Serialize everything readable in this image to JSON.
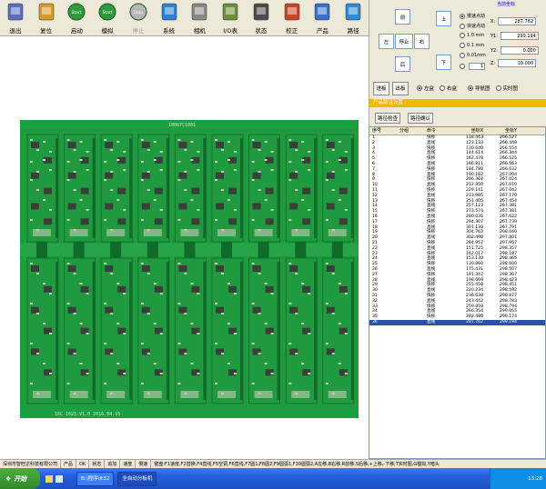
{
  "toolbar": {
    "items": [
      {
        "label": "退出",
        "icon": "exit-icon",
        "enabled": true
      },
      {
        "label": "复位",
        "icon": "reset-icon",
        "enabled": true
      },
      {
        "label": "启动",
        "icon": "start-icon",
        "enabled": true,
        "icon_text": "Start"
      },
      {
        "label": "模拟",
        "icon": "simulate-icon",
        "enabled": true,
        "icon_text": "Start"
      },
      {
        "label": "停止",
        "icon": "stop-icon",
        "enabled": false,
        "icon_text": "Stop"
      },
      {
        "label": "系统",
        "icon": "system-icon",
        "enabled": true
      },
      {
        "label": "相机",
        "icon": "camera-icon",
        "enabled": true
      },
      {
        "label": "I/O表",
        "icon": "io-icon",
        "enabled": true
      },
      {
        "label": "状态",
        "icon": "status-icon",
        "enabled": true
      },
      {
        "label": "校正",
        "icon": "calibrate-icon",
        "enabled": true
      },
      {
        "label": "产品",
        "icon": "product-icon",
        "enabled": true
      },
      {
        "label": "路径",
        "icon": "path-icon",
        "enabled": true
      }
    ]
  },
  "jog": {
    "front": "前",
    "back": "后",
    "left": "左",
    "right": "右",
    "stop": "停止",
    "up": "上",
    "down": "下"
  },
  "coords": {
    "title": "当前坐标",
    "speed_options": [
      {
        "label": "慢速点动",
        "selected": true
      },
      {
        "label": "快速点动",
        "selected": false
      },
      {
        "label": "1.0 mm",
        "selected": false
      },
      {
        "label": "0.1 mm",
        "selected": false
      },
      {
        "label": "0.01mm",
        "selected": false
      },
      {
        "label": "",
        "selected": false
      }
    ],
    "custom_step": "1",
    "x_label": "X:",
    "x_value": "287.762",
    "y_label": "Y1:",
    "y_value": "299.194",
    "y2_label": "Y2:",
    "y2_value": "0.000",
    "z_label": "Z:",
    "z_value": "10.000"
  },
  "mode": {
    "in_board": "进板",
    "out_board": "出板",
    "stations": [
      {
        "label": "左盒",
        "selected": true
      },
      {
        "label": "右盒",
        "selected": false
      }
    ],
    "views": [
      {
        "label": "导航图",
        "selected": true
      },
      {
        "label": "实时图",
        "selected": false
      }
    ]
  },
  "path_panel": {
    "title": "产品路径设置",
    "check_button": "路径检查",
    "confirm_button": "路径确认"
  },
  "table": {
    "headers": [
      "序号",
      "分组",
      "命令",
      "坐标X",
      "坐标Y"
    ],
    "rows": [
      [
        "1",
        "",
        "快移",
        "118.443",
        "266.527"
      ],
      [
        "2",
        "",
        "直线",
        "123.133",
        "266.448"
      ],
      [
        "3",
        "",
        "快移",
        "130.640",
        "266.554"
      ],
      [
        "4",
        "",
        "直线",
        "144.614",
        "266.344"
      ],
      [
        "5",
        "",
        "快移",
        "162.478",
        "266.525"
      ],
      [
        "6",
        "",
        "直线",
        "166.811",
        "266.563"
      ],
      [
        "7",
        "",
        "快移",
        "184.780",
        "266.632"
      ],
      [
        "8",
        "",
        "直线",
        "190.182",
        "267.004"
      ],
      [
        "9",
        "",
        "快移",
        "206.362",
        "267.024"
      ],
      [
        "10",
        "",
        "直线",
        "212.350",
        "267.010"
      ],
      [
        "11",
        "",
        "快移",
        "229.141",
        "267.042"
      ],
      [
        "12",
        "",
        "直线",
        "233.985",
        "267.170"
      ],
      [
        "13",
        "",
        "快移",
        "251.405",
        "267.454"
      ],
      [
        "14",
        "",
        "直线",
        "257.123",
        "267.381"
      ],
      [
        "15",
        "",
        "快移",
        "273.574",
        "267.381"
      ],
      [
        "16",
        "",
        "直线",
        "280.035",
        "267.622"
      ],
      [
        "17",
        "",
        "快移",
        "294.307",
        "267.739"
      ],
      [
        "18",
        "",
        "直线",
        "301.130",
        "267.791"
      ],
      [
        "19",
        "",
        "快移",
        "304.762",
        "298.040"
      ],
      [
        "20",
        "",
        "直线",
        "302.490",
        "297.801"
      ],
      [
        "21",
        "",
        "快移",
        "284.957",
        "297.957"
      ],
      [
        "22",
        "",
        "直线",
        "151.725",
        "298.357"
      ],
      [
        "23",
        "",
        "快移",
        "162.017",
        "298.187"
      ],
      [
        "24",
        "",
        "直线",
        "153.130",
        "298.465"
      ],
      [
        "25",
        "",
        "快移",
        "130.860",
        "298.600"
      ],
      [
        "26",
        "",
        "直线",
        "175.431",
        "298.507"
      ],
      [
        "27",
        "",
        "快移",
        "191.347",
        "298.307"
      ],
      [
        "28",
        "",
        "直线",
        "198.669",
        "298.423"
      ],
      [
        "29",
        "",
        "快移",
        "215.450",
        "298.451"
      ],
      [
        "30",
        "",
        "直线",
        "220.234",
        "298.592"
      ],
      [
        "31",
        "",
        "快移",
        "236.638",
        "298.877"
      ],
      [
        "32",
        "",
        "直线",
        "243.442",
        "298.783"
      ],
      [
        "33",
        "",
        "快移",
        "259.850",
        "298.794"
      ],
      [
        "34",
        "",
        "直线",
        "266.354",
        "299.055"
      ],
      [
        "35",
        "",
        "快移",
        "282.480",
        "299.174"
      ],
      [
        "36",
        "",
        "直线",
        "287.762",
        "299.194"
      ]
    ],
    "selected_index": 35
  },
  "board": {
    "top_label": "18067C1001",
    "bottom_label": "16C-1025-V1.0 2016.04.15",
    "boards_per_row": 9,
    "colors": {
      "board": "#1f9a3f",
      "dark": "#0f6b2a",
      "pad": "#c8cdb8",
      "chip": "#3a3f3a"
    }
  },
  "status": {
    "company": "深圳市智旺达科技有限公司",
    "product_label": "产品",
    "product_value": "OK",
    "state_label": "状态",
    "state_value": "追加",
    "speed_label": "速度",
    "speed_value": "慢速",
    "keys": "键盘:F1速度,F2替换,F4直线,F5空调,F6直线,F7圆1,F8圆2,F9圆弧1,F10圆弧2,A左移,B右移,R前移,S后移,+上移,-下移,T实时图,G模拟,Y暗头"
  },
  "taskbar": {
    "start": "开始",
    "tasks": [
      {
        "label": "B:\\程序\\ft32",
        "active": false
      },
      {
        "label": "全自动分板机",
        "active": true
      }
    ],
    "clock": "13:28"
  }
}
